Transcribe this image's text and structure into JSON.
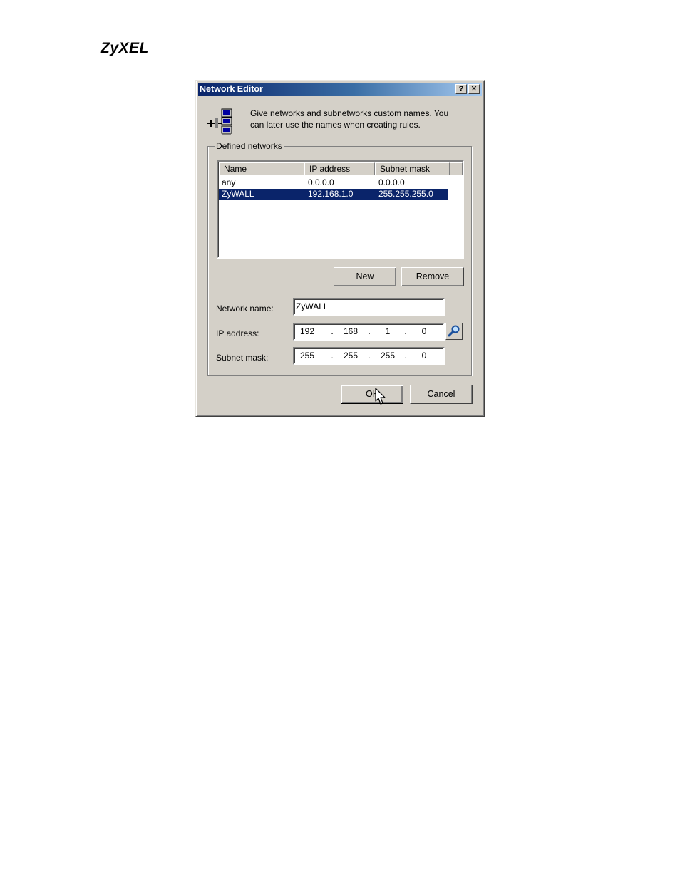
{
  "brand": {
    "logo_text": "ZyXEL"
  },
  "dialog": {
    "title": "Network Editor",
    "help_button": "?",
    "close_button": "✕",
    "intro_line1": "Give networks and subnetworks custom names. You",
    "intro_line2": "can later use the names when creating rules.",
    "group_label": "Defined networks",
    "columns": [
      "Name",
      "IP address",
      "Subnet mask"
    ],
    "rows": [
      {
        "name": "any",
        "ip": "0.0.0.0",
        "mask": "0.0.0.0",
        "selected": false
      },
      {
        "name": "ZyWALL",
        "ip": "192.168.1.0",
        "mask": "255.255.255.0",
        "selected": true
      }
    ],
    "new_button": "New",
    "remove_button": "Remove",
    "network_name_label": "Network name:",
    "network_name_value": "ZyWALL",
    "ip_label": "IP address:",
    "ip_parts": [
      "192",
      "168",
      "1",
      "0"
    ],
    "mask_label": "Subnet mask:",
    "mask_parts": [
      "255",
      "255",
      "255",
      "0"
    ],
    "ok_button": "OK",
    "cancel_button": "Cancel"
  },
  "colors": {
    "titlebar_start": "#0a246a",
    "titlebar_end": "#a6caf0",
    "selection": "#0a246a",
    "dialog_face": "#d4d0c8"
  },
  "icons": {
    "dialog_icon": "network-computers-icon",
    "lookup_icon": "magnifier-icon",
    "cursor": "mouse-pointer-icon"
  }
}
